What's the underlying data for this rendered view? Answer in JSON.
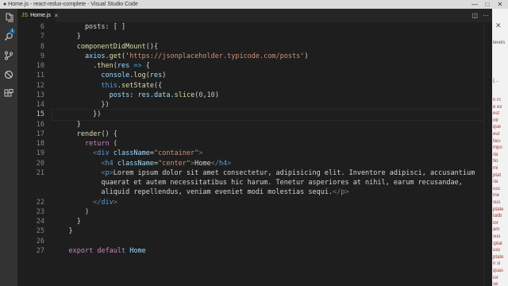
{
  "window": {
    "title": "● Home.js - react-redux-complete - Visual Studio Code",
    "controls": [
      "—",
      "□",
      "✕"
    ]
  },
  "activity_bar": {
    "items": [
      "files-icon",
      "search-icon",
      "source-control-icon",
      "debug-icon",
      "extensions-icon"
    ],
    "badge": "1"
  },
  "tabs": [
    {
      "label": "Home.js",
      "icon": "JS",
      "close": "✕"
    }
  ],
  "editor": {
    "line_numbers": [
      "6",
      "7",
      "8",
      "9",
      "10",
      "11",
      "12",
      "13",
      "14",
      "15",
      "16",
      "17",
      "18",
      "19",
      "20",
      "21",
      "",
      "",
      "22",
      "23",
      "24",
      "25",
      "26",
      "27",
      ""
    ],
    "active_line_index": 9,
    "lines": [
      [
        [
          "        posts: [ ]",
          "#d4d4d4"
        ]
      ],
      [
        [
          "      }",
          "#d4d4d4"
        ]
      ],
      [
        [
          "      ",
          "#d4d4d4"
        ],
        [
          "componentDidMount",
          "#dcdcaa"
        ],
        [
          "(){",
          "#d4d4d4"
        ]
      ],
      [
        [
          "        ",
          "#d4d4d4"
        ],
        [
          "axios",
          "#9cdcfe"
        ],
        [
          ".",
          "#d4d4d4"
        ],
        [
          "get",
          "#dcdcaa"
        ],
        [
          "('",
          "#d4d4d4"
        ],
        [
          "https://jsonplaceholder.typicode.com/posts",
          "#ce9178"
        ],
        [
          "')",
          "#d4d4d4"
        ]
      ],
      [
        [
          "          .",
          "#d4d4d4"
        ],
        [
          "then",
          "#dcdcaa"
        ],
        [
          "(",
          "#d4d4d4"
        ],
        [
          "res",
          "#9cdcfe"
        ],
        [
          " => ",
          "#569cd6"
        ],
        [
          "{",
          "#d4d4d4"
        ]
      ],
      [
        [
          "            ",
          "#d4d4d4"
        ],
        [
          "console",
          "#9cdcfe"
        ],
        [
          ".",
          "#d4d4d4"
        ],
        [
          "log",
          "#dcdcaa"
        ],
        [
          "(",
          "#d4d4d4"
        ],
        [
          "res",
          "#9cdcfe"
        ],
        [
          ")",
          "#d4d4d4"
        ]
      ],
      [
        [
          "            ",
          "#d4d4d4"
        ],
        [
          "this",
          "#569cd6"
        ],
        [
          ".",
          "#d4d4d4"
        ],
        [
          "setState",
          "#dcdcaa"
        ],
        [
          "({",
          "#d4d4d4"
        ]
      ],
      [
        [
          "              ",
          "#d4d4d4"
        ],
        [
          "posts",
          "#9cdcfe"
        ],
        [
          ": ",
          "#d4d4d4"
        ],
        [
          "res",
          "#9cdcfe"
        ],
        [
          ".",
          "#d4d4d4"
        ],
        [
          "data",
          "#9cdcfe"
        ],
        [
          ".",
          "#d4d4d4"
        ],
        [
          "slice",
          "#dcdcaa"
        ],
        [
          "(",
          "#d4d4d4"
        ],
        [
          "0",
          "#b5cea8"
        ],
        [
          ",",
          "#d4d4d4"
        ],
        [
          "10",
          "#b5cea8"
        ],
        [
          ")",
          "#d4d4d4"
        ]
      ],
      [
        [
          "            })",
          "#d4d4d4"
        ]
      ],
      [
        [
          "          })",
          "#d4d4d4"
        ]
      ],
      [
        [
          "      }",
          "#d4d4d4"
        ]
      ],
      [
        [
          "      ",
          "#d4d4d4"
        ],
        [
          "render",
          "#dcdcaa"
        ],
        [
          "() {",
          "#d4d4d4"
        ]
      ],
      [
        [
          "        ",
          "#d4d4d4"
        ],
        [
          "return",
          "#c586c0"
        ],
        [
          " (",
          "#d4d4d4"
        ]
      ],
      [
        [
          "          <",
          "#808080"
        ],
        [
          "div",
          "#569cd6"
        ],
        [
          " ",
          "#d4d4d4"
        ],
        [
          "className",
          "#9cdcfe"
        ],
        [
          "=",
          "#d4d4d4"
        ],
        [
          "\"container\"",
          "#ce9178"
        ],
        [
          ">",
          "#808080"
        ]
      ],
      [
        [
          "            <",
          "#808080"
        ],
        [
          "h4",
          "#569cd6"
        ],
        [
          " ",
          "#d4d4d4"
        ],
        [
          "className",
          "#9cdcfe"
        ],
        [
          "=",
          "#d4d4d4"
        ],
        [
          "\"center\"",
          "#ce9178"
        ],
        [
          ">",
          "#808080"
        ],
        [
          "Home",
          "#d4d4d4"
        ],
        [
          "</",
          "#808080"
        ],
        [
          "h4",
          "#569cd6"
        ],
        [
          ">",
          "#808080"
        ]
      ],
      [
        [
          "            <",
          "#808080"
        ],
        [
          "p",
          "#569cd6"
        ],
        [
          ">",
          "#808080"
        ],
        [
          "Lorem ipsum dolor sit amet consectetur, adipisicing elit. Inventore adipisci, accusantium",
          "#d4d4d4"
        ]
      ],
      [
        [
          "            quaerat et autem necessitatibus hic harum. Tenetur asperiores at nihil, earum recusandae,",
          "#d4d4d4"
        ]
      ],
      [
        [
          "            aliquid repellendus, veniam eveniet modi molestias sequi.",
          "#d4d4d4"
        ],
        [
          "</",
          "#808080"
        ],
        [
          "p",
          "#569cd6"
        ],
        [
          ">",
          "#808080"
        ]
      ],
      [
        [
          "          </",
          "#808080"
        ],
        [
          "div",
          "#569cd6"
        ],
        [
          ">",
          "#808080"
        ]
      ],
      [
        [
          "        )",
          "#d4d4d4"
        ]
      ],
      [
        [
          "      }",
          "#d4d4d4"
        ]
      ],
      [
        [
          "    }",
          "#d4d4d4"
        ]
      ],
      [
        [
          "",
          "#d4d4d4"
        ]
      ],
      [
        [
          "    ",
          "#d4d4d4"
        ],
        [
          "export",
          "#c586c0"
        ],
        [
          " ",
          "#d4d4d4"
        ],
        [
          "default",
          "#c586c0"
        ],
        [
          " ",
          "#d4d4d4"
        ],
        [
          "Home",
          "#9cdcfe"
        ]
      ],
      [
        [
          "",
          "#d4d4d4"
        ]
      ]
    ]
  },
  "side_panel": {
    "close": "✕",
    "words": [
      [
        "levels",
        "#555555"
      ],
      [
        "{...",
        "#555555"
      ],
      [
        "n rc",
        "#b03030"
      ],
      [
        "e ex",
        "#b03030"
      ],
      [
        "est",
        "#b03030"
      ],
      [
        "ntr",
        "#b03030"
      ],
      [
        "que",
        "#b03030"
      ],
      [
        "eur",
        "#b03030"
      ],
      [
        "facı",
        "#b03030"
      ],
      [
        "mpo",
        "#b03030"
      ],
      [
        "ıla",
        "#b03030"
      ],
      [
        "tio",
        "#b03030"
      ],
      [
        "mi",
        "#b03030"
      ],
      [
        "ptat",
        "#b03030"
      ],
      [
        "ıla",
        "#b03030"
      ],
      [
        "usc",
        "#b03030"
      ],
      [
        "ine",
        "#b03030"
      ],
      [
        "sus",
        "#b03030"
      ],
      [
        "ptate",
        "#b03030"
      ],
      [
        "tatib",
        "#b03030"
      ],
      [
        "ior",
        "#b03030"
      ],
      [
        "am",
        "#b03030"
      ],
      [
        "sus",
        "#b03030"
      ],
      [
        "ıptat",
        "#b03030"
      ],
      [
        "usc",
        "#b03030"
      ],
      [
        "ptate",
        "#b03030"
      ],
      [
        "n si",
        "#b03030"
      ],
      [
        "quas",
        "#b03030"
      ],
      [
        "ior",
        "#b03030"
      ],
      [
        "se",
        "#b03030"
      ]
    ]
  }
}
